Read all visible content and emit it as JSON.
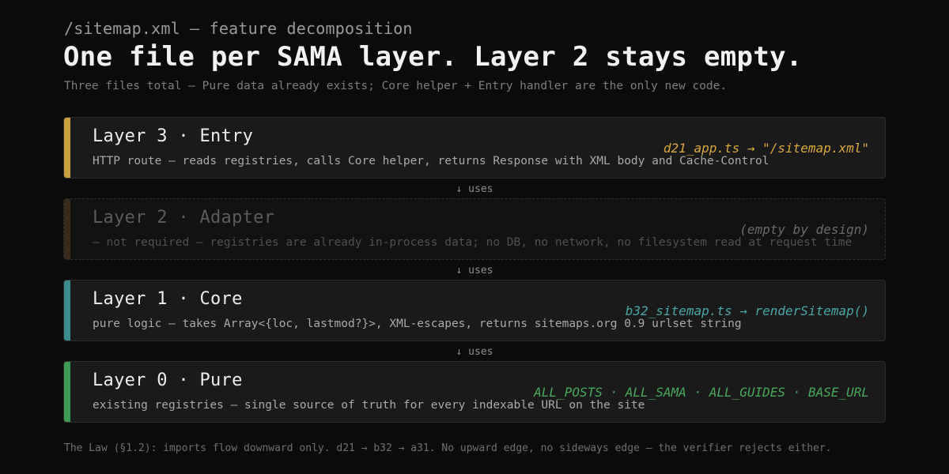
{
  "header": {
    "eyebrow": "/sitemap.xml — feature decomposition",
    "title": "One file per SAMA layer. Layer 2 stays empty.",
    "subtitle": "Three files total — Pure data already exists; Core helper + Entry handler are the only new code."
  },
  "layers": [
    {
      "title": "Layer 3 · Entry",
      "description": "HTTP route — reads registries, calls Core helper, returns Response with XML body and Cache-Control",
      "note": "d21_app.ts → \"/sitemap.xml\"",
      "accent": "#c9a03d",
      "note_color": "#d8a83c",
      "empty": false
    },
    {
      "title": "Layer 2 · Adapter",
      "description": "— not required — registries are already in-process data; no DB, no network, no filesystem read at request time",
      "note": "(empty by design)",
      "accent": "#3a2a1c",
      "note_color": "#6a6a6a",
      "empty": true
    },
    {
      "title": "Layer 1 · Core",
      "description": "pure logic — takes Array<{loc, lastmod?}>, XML-escapes, returns sitemaps.org 0.9 urlset string",
      "note": "b32_sitemap.ts → renderSitemap()",
      "accent": "#3b8c8c",
      "note_color": "#4aa6a6",
      "empty": false
    },
    {
      "title": "Layer 0 · Pure",
      "description": "existing registries — single source of truth for every indexable URL on the site",
      "note": "ALL_POSTS · ALL_SAMA · ALL_GUIDES · BASE_URL",
      "accent": "#3f9a55",
      "note_color": "#47a85c",
      "empty": false
    }
  ],
  "connectors": [
    {
      "label": "↓ uses"
    },
    {
      "label": "↓ uses"
    },
    {
      "label": "↓ uses"
    }
  ],
  "footer": {
    "text": "The Law (§1.2): imports flow downward only. d21 → b32 → a31. No upward edge, no sideways edge — the verifier rejects either."
  }
}
